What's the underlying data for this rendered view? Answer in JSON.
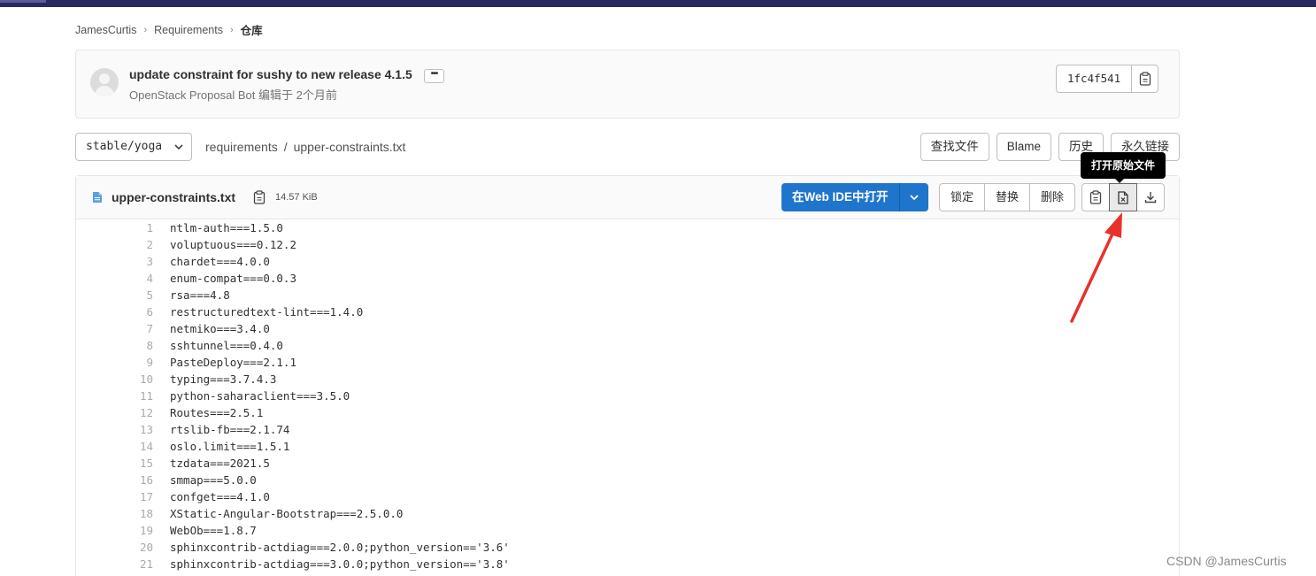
{
  "breadcrumb": {
    "items": [
      "JamesCurtis",
      "Requirements"
    ],
    "current": "仓库",
    "separator": "›"
  },
  "commit": {
    "title": "update constraint for sushy to new release 4.1.5",
    "ellipsis": "•••",
    "author": "OpenStack Proposal Bot",
    "meta_suffix": "编辑于 2个月前",
    "sha": "1fc4f541"
  },
  "nav": {
    "branch": "stable/yoga",
    "path": [
      "requirements",
      "upper-constraints.txt"
    ],
    "buttons": {
      "find_file": "查找文件",
      "blame": "Blame",
      "history": "历史",
      "permalink": "永久链接"
    }
  },
  "file": {
    "name": "upper-constraints.txt",
    "size": "14.57 KiB",
    "webide": "在Web IDE中打开",
    "lock": "锁定",
    "replace": "替换",
    "delete": "删除",
    "tooltip": "打开原始文件",
    "lines": [
      "ntlm-auth===1.5.0",
      "voluptuous===0.12.2",
      "chardet===4.0.0",
      "enum-compat===0.0.3",
      "rsa===4.8",
      "restructuredtext-lint===1.4.0",
      "netmiko===3.4.0",
      "sshtunnel===0.4.0",
      "PasteDeploy===2.1.1",
      "typing===3.7.4.3",
      "python-saharaclient===3.5.0",
      "Routes===2.5.1",
      "rtslib-fb===2.1.74",
      "oslo.limit===1.5.1",
      "tzdata===2021.5",
      "smmap===5.0.0",
      "confget===4.1.0",
      "XStatic-Angular-Bootstrap===2.5.0.0",
      "WebOb===1.8.7",
      "sphinxcontrib-actdiag===2.0.0;python_version=='3.6'",
      "sphinxcontrib-actdiag===3.0.0;python_version=='3.8'"
    ]
  },
  "watermark": "CSDN @JamesCurtis",
  "colors": {
    "primary": "#1f75cb",
    "topbar": "#292961",
    "annotation": "#e8312b"
  }
}
